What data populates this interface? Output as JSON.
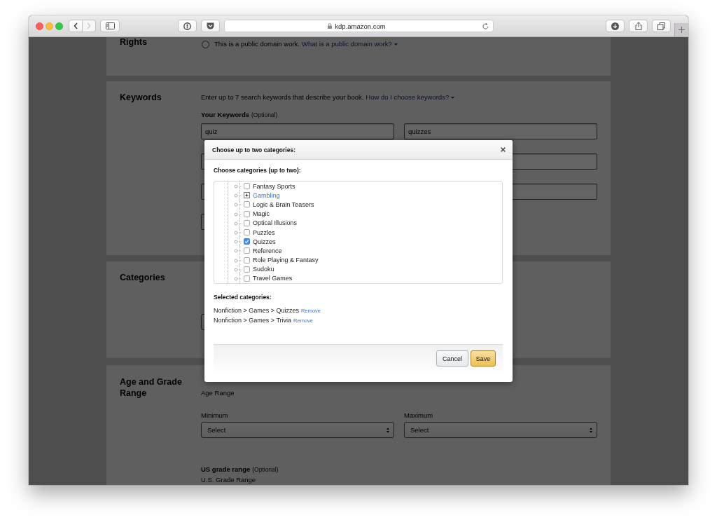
{
  "browser": {
    "nav": [
      {
        "kind": "back",
        "disabled": false
      },
      {
        "kind": "forward",
        "disabled": true
      }
    ],
    "url": "kdp.amazon.com"
  },
  "rights": {
    "title": "Rights",
    "option": {
      "label": "This is a public domain work.",
      "selected": false
    },
    "help_link": "What is a public domain work?"
  },
  "keywords": {
    "title": "Keywords",
    "description": "Enter up to 7 search keywords that describe your book.",
    "help_link": "How do I choose keywords?",
    "label": "Your Keywords",
    "note": "(Optional)",
    "fields": [
      {
        "kind": "text",
        "value": "quiz"
      },
      {
        "kind": "text",
        "value": "quizzes"
      },
      {
        "kind": "text"
      },
      {
        "kind": "text"
      },
      {
        "kind": "text"
      },
      {
        "kind": "text"
      },
      {
        "kind": "text"
      }
    ]
  },
  "categories": {
    "title": "Categories"
  },
  "age_and_grade": {
    "title": "Age and Grade Range",
    "age_label": "Age Range",
    "selects": [
      {
        "label": "Minimum",
        "value": "Select"
      },
      {
        "label": "Maximum",
        "value": "Select"
      }
    ],
    "grade_heading": "US grade range",
    "grade_note": "(Optional)",
    "grade_label": "U.S. Grade Range"
  },
  "dialog": {
    "title": "Choose up to two categories:",
    "prompt": "Choose categories (up to two):",
    "tree": [
      {
        "kind": "checkbox",
        "label": "Fantasy Sports",
        "checked": false
      },
      {
        "kind": "expander",
        "label": "Gambling",
        "expanded": false
      },
      {
        "kind": "checkbox",
        "label": "Logic & Brain Teasers",
        "checked": false
      },
      {
        "kind": "checkbox",
        "label": "Magic",
        "checked": false
      },
      {
        "kind": "checkbox",
        "label": "Optical Illusions",
        "checked": false
      },
      {
        "kind": "checkbox",
        "label": "Puzzles",
        "checked": false
      },
      {
        "kind": "checkbox",
        "label": "Quizzes",
        "checked": true
      },
      {
        "kind": "checkbox",
        "label": "Reference",
        "checked": false
      },
      {
        "kind": "checkbox",
        "label": "Role Playing & Fantasy",
        "checked": false
      },
      {
        "kind": "checkbox",
        "label": "Sudoku",
        "checked": false
      },
      {
        "kind": "checkbox",
        "label": "Travel Games",
        "checked": false
      }
    ],
    "selected_heading": "Selected categories:",
    "selected": [
      {
        "path": "Nonfiction > Games > Quizzes",
        "action": "Remove"
      },
      {
        "path": "Nonfiction > Games > Trivia",
        "action": "Remove"
      }
    ],
    "buttons": [
      {
        "kind": "secondary",
        "label": "Cancel"
      },
      {
        "kind": "primary",
        "label": "Save"
      }
    ]
  }
}
